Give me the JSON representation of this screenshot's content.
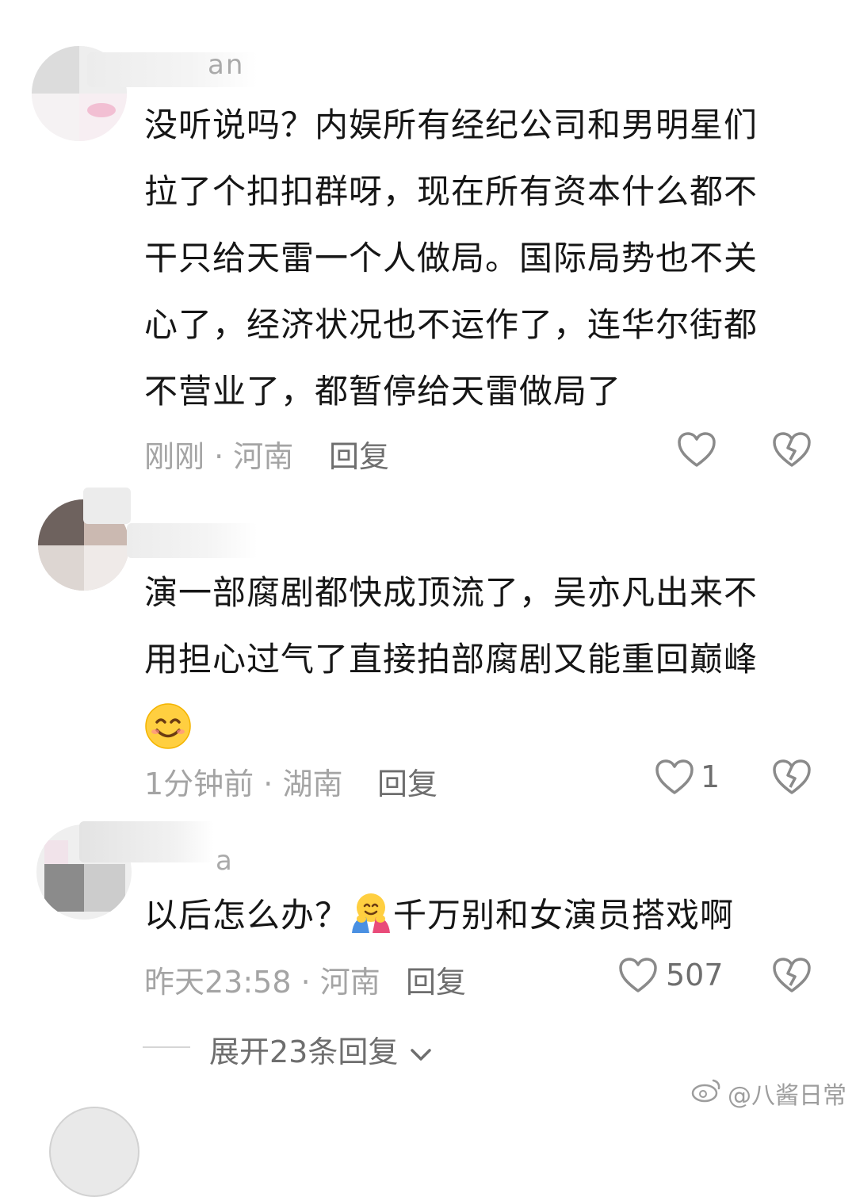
{
  "comments": [
    {
      "name_fragment": "an",
      "text": "没听说吗？内娱所有经纪公司和男明星们拉了个扣扣群呀，现在所有资本什么都不干只给天雷一个人做局。国际局势也不关心了，经济状况也不运作了，连华尔街都不营业了，都暂停给天雷做局了",
      "lines": [
        "没听说吗？内娱所有经纪公司和男明星们",
        "拉了个扣扣群呀，现在所有资本什么都不",
        "干只给天雷一个人做局。国际局势也不关",
        "心了，经济状况也不运作了，连华尔街都",
        "不营业了，都暂停给天雷做局了"
      ],
      "time": "刚刚",
      "location": "河南",
      "reply_label": "回复",
      "likes": ""
    },
    {
      "name_fragment": "",
      "lines": [
        "演一部腐剧都快成顶流了，吴亦凡出来不",
        "用担心过气了直接拍部腐剧又能重回巅峰"
      ],
      "emoji": "smiling-face-icon",
      "time": "1分钟前",
      "location": "湖南",
      "reply_label": "回复",
      "likes": "1"
    },
    {
      "name_fragment": "a",
      "text_before_emoji": "以后怎么办？",
      "emoji": "hugging-face-icon",
      "text_after_emoji": "千万别和女演员搭戏啊",
      "time": "昨天23:58",
      "location": "河南",
      "reply_label": "回复",
      "likes": "507"
    }
  ],
  "separator": "·",
  "expand_replies": "展开23条回复",
  "watermark": "@八酱日常",
  "colors": {
    "text": "#161616",
    "meta": "#a4a4a4",
    "icon": "#8a8a8a"
  }
}
